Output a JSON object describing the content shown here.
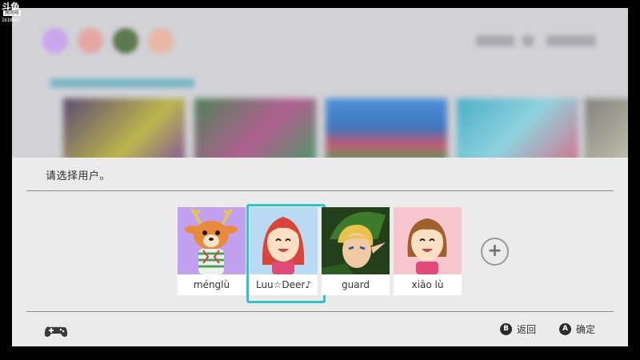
{
  "watermark": {
    "logo": "斗鱼",
    "tag": "房间号",
    "room": "1610681"
  },
  "dialog": {
    "prompt": "请选择用户。",
    "users": [
      {
        "name": "ménglù",
        "avatar": "deer-villager-avatar-icon",
        "bg": "#c2a0f0",
        "selected": false
      },
      {
        "name": "Luu☆Deer♪",
        "avatar": "mii-red-hair-avatar-icon",
        "bg": "#b9daf3",
        "selected": true
      },
      {
        "name": "guard",
        "avatar": "link-green-cap-avatar-icon",
        "bg": "#2f5a22",
        "selected": false
      },
      {
        "name": "xiāo lù",
        "avatar": "mii-brown-hair-avatar-icon",
        "bg": "#f7c6cf",
        "selected": false
      }
    ],
    "add_user_icon": "plus-icon",
    "controller_icon": "controller-icon",
    "back": {
      "button": "B",
      "label": "返回"
    },
    "confirm": {
      "button": "A",
      "label": "确定"
    }
  },
  "colors": {
    "selection": "#30c4c8",
    "dialog_bg": "#ebebeb",
    "active_dot": "#35c63c"
  }
}
